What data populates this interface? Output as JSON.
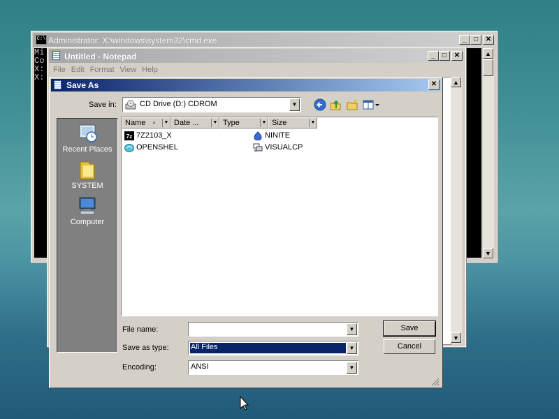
{
  "cmd_window": {
    "title": "Administrator: X:\\windows\\system32\\cmd.exe",
    "console_lines": [
      "Mi",
      "Co",
      "",
      "X:",
      "",
      "X:"
    ],
    "caption_buttons": [
      "_",
      "□",
      "✕"
    ]
  },
  "notepad": {
    "title": "Untitled - Notepad",
    "menu": [
      "File",
      "Edit",
      "Format",
      "View",
      "Help"
    ],
    "caption_buttons": [
      "_",
      "□",
      "✕"
    ]
  },
  "save_dialog": {
    "title": "Save As",
    "close_label": "✕",
    "save_in_label": "Save in:",
    "save_in_value": "CD Drive (D:) CDROM",
    "places": [
      "Recent Places",
      "SYSTEM",
      "Computer"
    ],
    "columns": [
      "Name",
      "Date ...",
      "Type",
      "Size"
    ],
    "files": [
      {
        "name": "7Z2103_X",
        "icon": "7zip-icon"
      },
      {
        "name": "NINITE",
        "icon": "ninite-icon"
      },
      {
        "name": "OPENSHEL",
        "icon": "openshell-icon"
      },
      {
        "name": "VISUALCP",
        "icon": "setup-icon"
      }
    ],
    "file_name_label": "File name:",
    "file_name_value": "",
    "save_as_type_label": "Save as type:",
    "save_as_type_value": "All Files",
    "encoding_label": "Encoding:",
    "encoding_value": "ANSI",
    "save_button": "Save",
    "cancel_button": "Cancel"
  },
  "colors": {
    "dialog_title_start": "#0a246a",
    "dialog_title_end": "#a6caf0",
    "selection": "#0a246a",
    "chrome": "#d4d0c8"
  }
}
